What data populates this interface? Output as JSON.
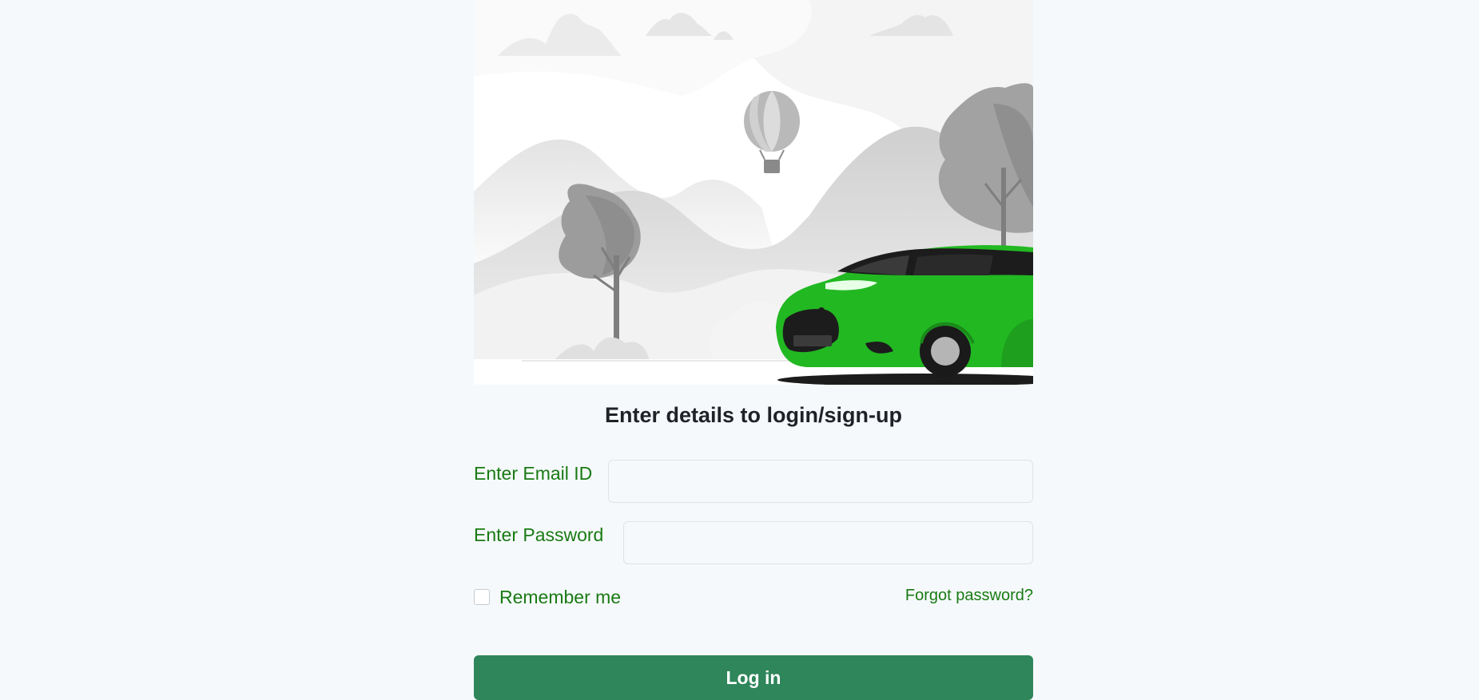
{
  "login": {
    "heading": "Enter details to login/sign-up",
    "email_label": "Enter Email ID",
    "email_value": "",
    "password_label": "Enter Password",
    "password_value": "",
    "remember_label": "Remember me",
    "remember_checked": false,
    "forgot_link": "Forgot password?",
    "login_button": "Log in"
  },
  "illustration": {
    "subject": "car-illustration",
    "car_color": "#22b822"
  },
  "colors": {
    "background": "#f5f9fb",
    "accent_text": "#1a7a14",
    "button": "#2e865a",
    "heading": "#1f2328"
  }
}
